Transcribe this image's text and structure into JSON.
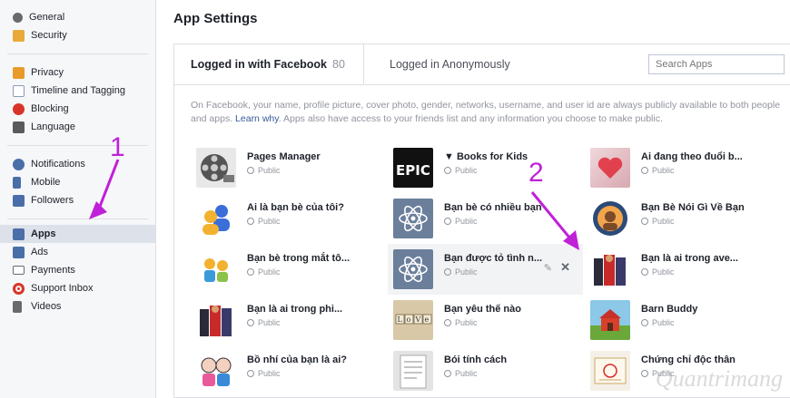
{
  "sidebar": {
    "group1": [
      {
        "label": "General",
        "icon": "gears-icon",
        "color": "#6a6a6a"
      },
      {
        "label": "Security",
        "icon": "badge-icon",
        "color": "#e8a93a"
      }
    ],
    "group2": [
      {
        "label": "Privacy",
        "icon": "lock-icon",
        "color": "#e89a2a"
      },
      {
        "label": "Timeline and Tagging",
        "icon": "timeline-icon",
        "color": "#8a9bb8"
      },
      {
        "label": "Blocking",
        "icon": "block-icon",
        "color": "#d8352a"
      },
      {
        "label": "Language",
        "icon": "language-icon",
        "color": "#5a5a5a"
      }
    ],
    "group3": [
      {
        "label": "Notifications",
        "icon": "globe-icon",
        "color": "#4a6ea8"
      },
      {
        "label": "Mobile",
        "icon": "phone-icon",
        "color": "#4a6ea8"
      },
      {
        "label": "Followers",
        "icon": "rss-icon",
        "color": "#4a6ea8"
      }
    ],
    "group4": [
      {
        "label": "Apps",
        "icon": "apps-icon",
        "color": "#4a6ea8",
        "active": true
      },
      {
        "label": "Ads",
        "icon": "ads-icon",
        "color": "#4a6ea8"
      },
      {
        "label": "Payments",
        "icon": "card-icon",
        "color": "#6a6a6a"
      },
      {
        "label": "Support Inbox",
        "icon": "lifebuoy-icon",
        "color": "#d8352a"
      },
      {
        "label": "Videos",
        "icon": "film-icon",
        "color": "#6a6a6a"
      }
    ]
  },
  "main": {
    "title": "App Settings",
    "tabs": {
      "logged_in": "Logged in with Facebook",
      "count": "80",
      "anonymous": "Logged in Anonymously"
    },
    "search_placeholder": "Search Apps",
    "intro_before": "On Facebook, your name, profile picture, cover photo, gender, networks, username, and user id are always publicly available to both people and apps. ",
    "intro_link": "Learn why",
    "intro_after": ". Apps also have access to your friends list and any information you choose to make public."
  },
  "apps": [
    {
      "name": "Pages Manager",
      "privacy": "Public",
      "icon": "film-reel-icon",
      "bg": "#e8e8e8"
    },
    {
      "name": "▼ Books for Kids",
      "privacy": "Public",
      "icon": "epic-logo-icon",
      "bg": "#111111"
    },
    {
      "name": "Ai đang theo đuổi b...",
      "privacy": "Public",
      "icon": "heart-blur-icon",
      "bg": "#e8c8cc"
    },
    {
      "name": "Ai là bạn bè của tôi?",
      "privacy": "Public",
      "icon": "users-icon",
      "bg": "#ffffff"
    },
    {
      "name": "Bạn bè có nhiều bạn",
      "privacy": "Public",
      "icon": "atom-icon",
      "bg": "#6b7f9b"
    },
    {
      "name": "Bạn Bè Nói Gì Về Bạn",
      "privacy": "Public",
      "icon": "avatar-circle-icon",
      "bg": "#2c4a78"
    },
    {
      "name": "Bạn bè trong mắt tô...",
      "privacy": "Public",
      "icon": "friends-icon",
      "bg": "#ffffff"
    },
    {
      "name": "Bạn được tỏ tình n...",
      "privacy": "Public",
      "icon": "atom-icon",
      "bg": "#6b7f9b",
      "hover": true
    },
    {
      "name": "Bạn là ai trong ave...",
      "privacy": "Public",
      "icon": "heroes-icon",
      "bg": "#5a2a2a"
    },
    {
      "name": "Bạn là ai trong phi...",
      "privacy": "Public",
      "icon": "heroes-icon",
      "bg": "#5a2a2a"
    },
    {
      "name": "Bạn yêu thế nào",
      "privacy": "Public",
      "icon": "love-blocks-icon",
      "bg": "#d8c8a8"
    },
    {
      "name": "Barn Buddy",
      "privacy": "Public",
      "icon": "barn-icon",
      "bg": "#7ab04a"
    },
    {
      "name": "Bồ nhí của bạn là ai?",
      "privacy": "Public",
      "icon": "couple-icon",
      "bg": "#ffffff"
    },
    {
      "name": "Bói tính cách",
      "privacy": "Public",
      "icon": "document-icon",
      "bg": "#dcdcdc"
    },
    {
      "name": "Chứng chỉ độc thân",
      "privacy": "Public",
      "icon": "certificate-icon",
      "bg": "#f4f0e8"
    }
  ],
  "annotations": {
    "one": "1",
    "two": "2",
    "color": "#c020d8"
  },
  "watermark": "Quantrimang"
}
